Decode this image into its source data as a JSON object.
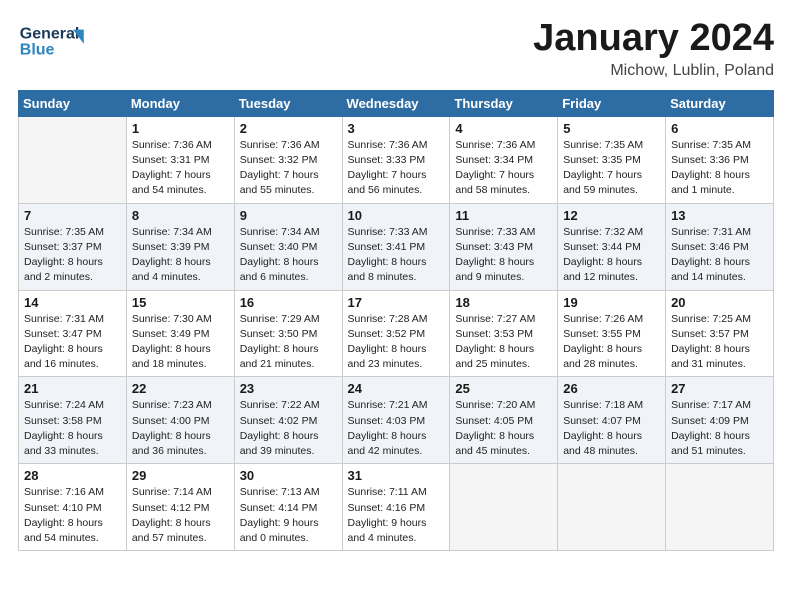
{
  "logo": {
    "line1": "General",
    "line2": "Blue"
  },
  "title": "January 2024",
  "location": "Michow, Lublin, Poland",
  "days_of_week": [
    "Sunday",
    "Monday",
    "Tuesday",
    "Wednesday",
    "Thursday",
    "Friday",
    "Saturday"
  ],
  "weeks": [
    [
      {
        "day": "",
        "info": ""
      },
      {
        "day": "1",
        "info": "Sunrise: 7:36 AM\nSunset: 3:31 PM\nDaylight: 7 hours\nand 54 minutes."
      },
      {
        "day": "2",
        "info": "Sunrise: 7:36 AM\nSunset: 3:32 PM\nDaylight: 7 hours\nand 55 minutes."
      },
      {
        "day": "3",
        "info": "Sunrise: 7:36 AM\nSunset: 3:33 PM\nDaylight: 7 hours\nand 56 minutes."
      },
      {
        "day": "4",
        "info": "Sunrise: 7:36 AM\nSunset: 3:34 PM\nDaylight: 7 hours\nand 58 minutes."
      },
      {
        "day": "5",
        "info": "Sunrise: 7:35 AM\nSunset: 3:35 PM\nDaylight: 7 hours\nand 59 minutes."
      },
      {
        "day": "6",
        "info": "Sunrise: 7:35 AM\nSunset: 3:36 PM\nDaylight: 8 hours\nand 1 minute."
      }
    ],
    [
      {
        "day": "7",
        "info": "Sunrise: 7:35 AM\nSunset: 3:37 PM\nDaylight: 8 hours\nand 2 minutes."
      },
      {
        "day": "8",
        "info": "Sunrise: 7:34 AM\nSunset: 3:39 PM\nDaylight: 8 hours\nand 4 minutes."
      },
      {
        "day": "9",
        "info": "Sunrise: 7:34 AM\nSunset: 3:40 PM\nDaylight: 8 hours\nand 6 minutes."
      },
      {
        "day": "10",
        "info": "Sunrise: 7:33 AM\nSunset: 3:41 PM\nDaylight: 8 hours\nand 8 minutes."
      },
      {
        "day": "11",
        "info": "Sunrise: 7:33 AM\nSunset: 3:43 PM\nDaylight: 8 hours\nand 9 minutes."
      },
      {
        "day": "12",
        "info": "Sunrise: 7:32 AM\nSunset: 3:44 PM\nDaylight: 8 hours\nand 12 minutes."
      },
      {
        "day": "13",
        "info": "Sunrise: 7:31 AM\nSunset: 3:46 PM\nDaylight: 8 hours\nand 14 minutes."
      }
    ],
    [
      {
        "day": "14",
        "info": "Sunrise: 7:31 AM\nSunset: 3:47 PM\nDaylight: 8 hours\nand 16 minutes."
      },
      {
        "day": "15",
        "info": "Sunrise: 7:30 AM\nSunset: 3:49 PM\nDaylight: 8 hours\nand 18 minutes."
      },
      {
        "day": "16",
        "info": "Sunrise: 7:29 AM\nSunset: 3:50 PM\nDaylight: 8 hours\nand 21 minutes."
      },
      {
        "day": "17",
        "info": "Sunrise: 7:28 AM\nSunset: 3:52 PM\nDaylight: 8 hours\nand 23 minutes."
      },
      {
        "day": "18",
        "info": "Sunrise: 7:27 AM\nSunset: 3:53 PM\nDaylight: 8 hours\nand 25 minutes."
      },
      {
        "day": "19",
        "info": "Sunrise: 7:26 AM\nSunset: 3:55 PM\nDaylight: 8 hours\nand 28 minutes."
      },
      {
        "day": "20",
        "info": "Sunrise: 7:25 AM\nSunset: 3:57 PM\nDaylight: 8 hours\nand 31 minutes."
      }
    ],
    [
      {
        "day": "21",
        "info": "Sunrise: 7:24 AM\nSunset: 3:58 PM\nDaylight: 8 hours\nand 33 minutes."
      },
      {
        "day": "22",
        "info": "Sunrise: 7:23 AM\nSunset: 4:00 PM\nDaylight: 8 hours\nand 36 minutes."
      },
      {
        "day": "23",
        "info": "Sunrise: 7:22 AM\nSunset: 4:02 PM\nDaylight: 8 hours\nand 39 minutes."
      },
      {
        "day": "24",
        "info": "Sunrise: 7:21 AM\nSunset: 4:03 PM\nDaylight: 8 hours\nand 42 minutes."
      },
      {
        "day": "25",
        "info": "Sunrise: 7:20 AM\nSunset: 4:05 PM\nDaylight: 8 hours\nand 45 minutes."
      },
      {
        "day": "26",
        "info": "Sunrise: 7:18 AM\nSunset: 4:07 PM\nDaylight: 8 hours\nand 48 minutes."
      },
      {
        "day": "27",
        "info": "Sunrise: 7:17 AM\nSunset: 4:09 PM\nDaylight: 8 hours\nand 51 minutes."
      }
    ],
    [
      {
        "day": "28",
        "info": "Sunrise: 7:16 AM\nSunset: 4:10 PM\nDaylight: 8 hours\nand 54 minutes."
      },
      {
        "day": "29",
        "info": "Sunrise: 7:14 AM\nSunset: 4:12 PM\nDaylight: 8 hours\nand 57 minutes."
      },
      {
        "day": "30",
        "info": "Sunrise: 7:13 AM\nSunset: 4:14 PM\nDaylight: 9 hours\nand 0 minutes."
      },
      {
        "day": "31",
        "info": "Sunrise: 7:11 AM\nSunset: 4:16 PM\nDaylight: 9 hours\nand 4 minutes."
      },
      {
        "day": "",
        "info": ""
      },
      {
        "day": "",
        "info": ""
      },
      {
        "day": "",
        "info": ""
      }
    ]
  ]
}
